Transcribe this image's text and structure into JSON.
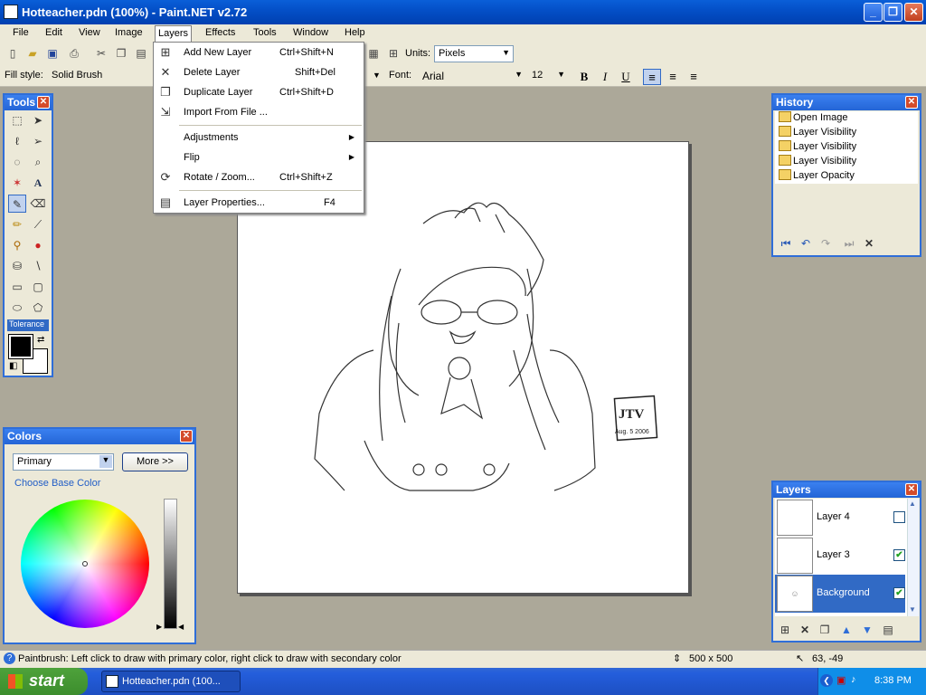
{
  "window": {
    "title": "Hotteacher.pdn (100%) - Paint.NET v2.72"
  },
  "menu": {
    "file": "File",
    "edit": "Edit",
    "view": "View",
    "image": "Image",
    "layers": "Layers",
    "effects": "Effects",
    "tools": "Tools",
    "window": "Window",
    "help": "Help"
  },
  "toolbar": {
    "units_label": "Units:",
    "units_value": "Pixels",
    "fill_style_label": "Fill style:",
    "fill_style_value": "Solid Brush",
    "font_label": "Font:",
    "font_value": "Arial",
    "font_size": "12",
    "bold": "B",
    "italic": "I",
    "underline": "U"
  },
  "layers_menu": {
    "items": [
      {
        "label": "Add New Layer",
        "shortcut": "Ctrl+Shift+N",
        "icon": "add-layer-icon"
      },
      {
        "label": "Delete Layer",
        "shortcut": "Shift+Del",
        "icon": "delete-icon"
      },
      {
        "label": "Duplicate Layer",
        "shortcut": "Ctrl+Shift+D",
        "icon": "duplicate-icon"
      },
      {
        "label": "Import From File ...",
        "shortcut": "",
        "icon": "import-icon"
      },
      {
        "label": "Adjustments",
        "shortcut": "",
        "icon": ""
      },
      {
        "label": "Flip",
        "shortcut": "",
        "icon": ""
      },
      {
        "label": "Rotate / Zoom...",
        "shortcut": "Ctrl+Shift+Z",
        "icon": "rotate-zoom-icon"
      },
      {
        "label": "Layer Properties...",
        "shortcut": "F4",
        "icon": "properties-icon"
      }
    ]
  },
  "tools_panel": {
    "title": "Tools",
    "tolerance_label": "Tolerance"
  },
  "history_panel": {
    "title": "History",
    "items": [
      "Open Image",
      "Layer Visibility",
      "Layer Visibility",
      "Layer Visibility",
      "Layer Opacity"
    ]
  },
  "colors_panel": {
    "title": "Colors",
    "mode_value": "Primary",
    "more_button": "More >>",
    "choose_label": "Choose Base Color"
  },
  "layers_panel": {
    "title": "Layers",
    "layers": [
      {
        "name": "Layer 4",
        "visible": false
      },
      {
        "name": "Layer 3",
        "visible": true
      },
      {
        "name": "Background",
        "visible": true
      }
    ]
  },
  "artwork": {
    "signature": "JTV",
    "date_stamp": "Aug. 5 2006"
  },
  "status": {
    "message": "Paintbrush: Left click to draw with primary color, right click to draw with secondary color",
    "image_size": "500 x 500",
    "cursor_pos": "63, -49"
  },
  "taskbar": {
    "start": "start",
    "task_item": "Hotteacher.pdn (100...",
    "clock": "8:38 PM"
  },
  "colors": {
    "accent": "#2f6ed8",
    "selection": "#316ac5",
    "chrome": "#ece9d8",
    "workspace": "#aca899"
  }
}
